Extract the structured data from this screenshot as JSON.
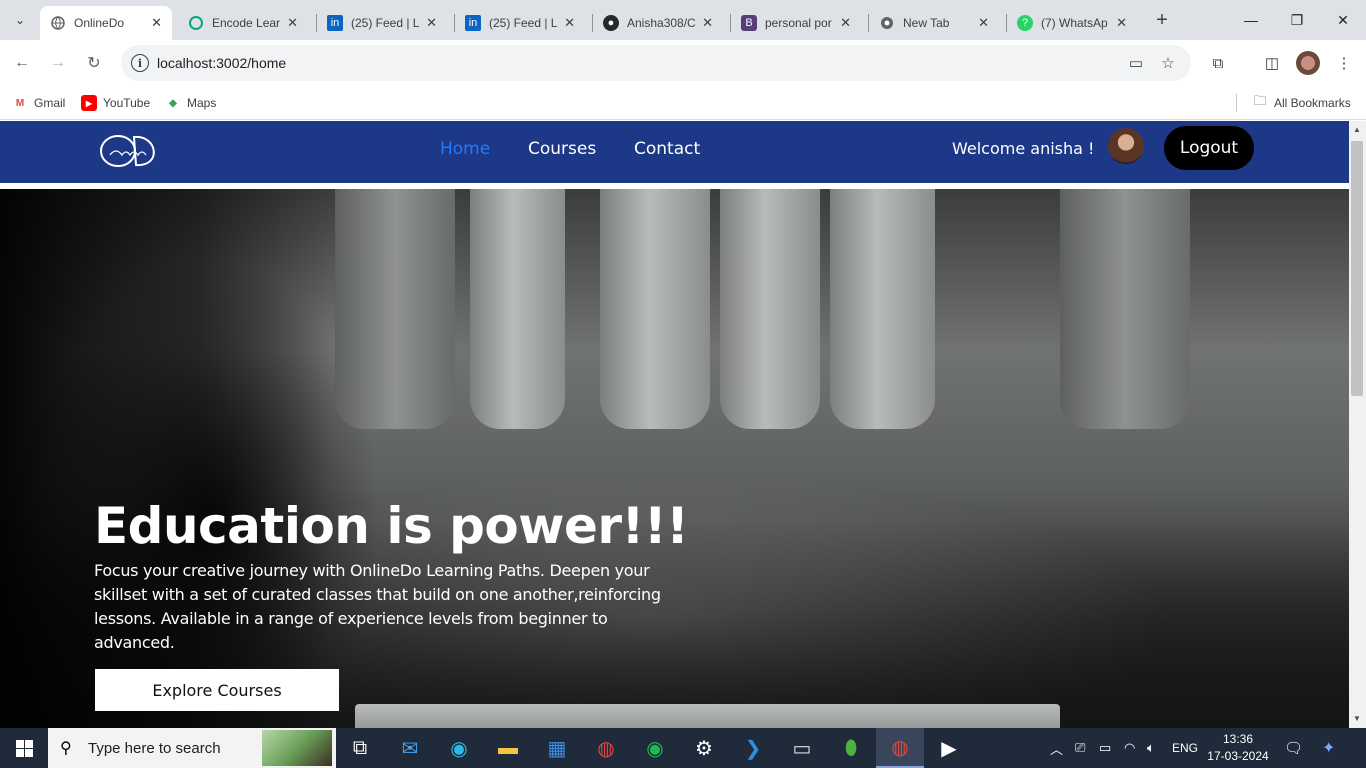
{
  "browser": {
    "tabs": [
      {
        "title": "OnlineDo",
        "active": true
      },
      {
        "title": "Encode Lear",
        "active": false
      },
      {
        "title": "(25) Feed | Li",
        "active": false
      },
      {
        "title": "(25) Feed | Li",
        "active": false
      },
      {
        "title": "Anisha308/C",
        "active": false
      },
      {
        "title": "personal por",
        "active": false
      },
      {
        "title": "New Tab",
        "active": false
      },
      {
        "title": "(7) WhatsAp",
        "active": false
      }
    ],
    "url": "localhost:3002/home",
    "bookmarks": [
      {
        "label": "Gmail"
      },
      {
        "label": "YouTube"
      },
      {
        "label": "Maps"
      }
    ],
    "all_bookmarks": "All Bookmarks"
  },
  "site": {
    "nav": {
      "links": [
        {
          "label": "Home",
          "active": true
        },
        {
          "label": "Courses",
          "active": false
        },
        {
          "label": "Contact",
          "active": false
        }
      ],
      "welcome": "Welcome anisha !",
      "logout": "Logout"
    },
    "hero": {
      "title": "Education is power!!!",
      "text": "Focus your creative journey with OnlineDo Learning Paths. Deepen your skillset with a set of curated classes that build on one another,reinforcing lessons. Available in a range of experience levels from beginner to advanced.",
      "cta": "Explore Courses"
    },
    "brand_color": "#1c3887",
    "active_link_color": "#1e7bff"
  },
  "taskbar": {
    "search_placeholder": "Type here to search",
    "language": "ENG",
    "time": "13:36",
    "date": "17-03-2024"
  }
}
